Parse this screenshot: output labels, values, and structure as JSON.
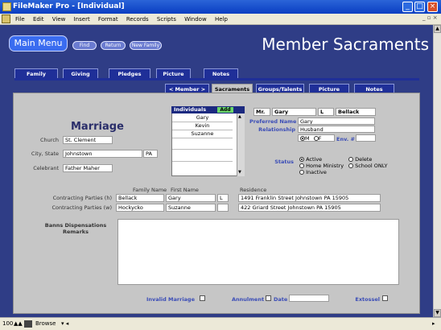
{
  "window": {
    "title": "FileMaker Pro - [Individual]"
  },
  "menu": [
    "File",
    "Edit",
    "View",
    "Insert",
    "Format",
    "Records",
    "Scripts",
    "Window",
    "Help"
  ],
  "toolbar": {
    "main_menu": "Main Menu",
    "find": "Find",
    "return": "Return",
    "new_family": "New Family",
    "title": "Member Sacraments"
  },
  "tabs_top": [
    "Family",
    "Giving",
    "Pledges",
    "Picture",
    "Notes"
  ],
  "tabs_sub": {
    "member": "Member",
    "sacraments": "Sacraments",
    "groups": "Groups/Talents",
    "picture": "Picture",
    "notes": "Notes"
  },
  "section_title": "Marriage",
  "left_form": {
    "church_label": "Church",
    "church_value": "St. Clement",
    "city_label": "City, State",
    "city_value": "Johnstown",
    "state_value": "PA",
    "celebrant_label": "Celebrant",
    "celebrant_value": "Father Maher"
  },
  "individuals": {
    "header": "Individuals",
    "add": "Add",
    "items": [
      "Gary",
      "Kevin",
      "Suzanne"
    ]
  },
  "person": {
    "prefix": "Mr.",
    "first": "Gary",
    "middle": "L",
    "last": "Bellack",
    "preferred_label": "Preferred Name",
    "preferred_value": "Gary",
    "relationship_label": "Relationship",
    "relationship_value": "Husband",
    "gender_m": "M",
    "gender_f": "F",
    "env_label": "Env. #",
    "status_label": "Status",
    "status_active": "Active",
    "status_delete": "Delete",
    "status_home": "Home Ministry",
    "status_school": "School ONLY",
    "status_inactive": "Inactive"
  },
  "table": {
    "col_family": "Family Name",
    "col_first": "First Name",
    "col_residence": "Residence",
    "row_h_label": "Contracting Parties (h)",
    "row_h": {
      "family": "Bellack",
      "first": "Gary",
      "mi": "L",
      "residence": "1491 Franklin Street Johnstown PA 15905"
    },
    "row_w_label": "Contracting Parties (w)",
    "row_w": {
      "family": "Hockycko",
      "first": "Suzanne",
      "mi": "",
      "residence": "422 Griard Street Johnstown PA 15905"
    }
  },
  "remarks_label_1": "Banns Dispensations",
  "remarks_label_2": "Remarks",
  "bottom": {
    "invalid": "Invalid Marriage",
    "annulment": "Annulment",
    "date": "Date",
    "extosszel": "Extossel"
  },
  "status": {
    "zoom": "100",
    "mode": "Browse"
  }
}
